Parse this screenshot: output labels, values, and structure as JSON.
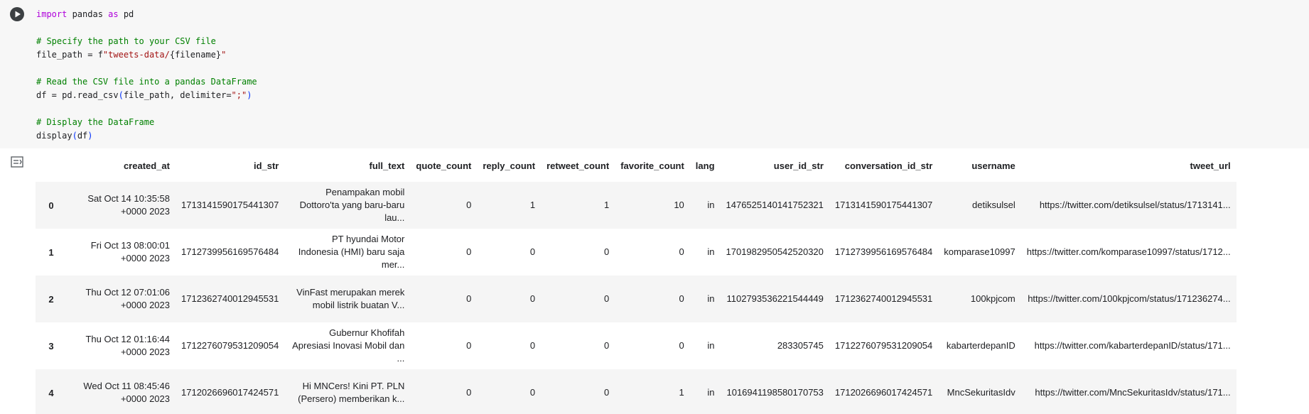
{
  "code": {
    "line1": {
      "kw1": "import",
      "mid": " pandas ",
      "kw2": "as",
      "end": " pd"
    },
    "line3": "# Specify the path to your CSV file",
    "line4": {
      "a": "file_path = f",
      "b": "\"tweets-data/",
      "c": "{filename}",
      "d": "\""
    },
    "line6": "# Read the CSV file into a pandas DataFrame",
    "line7": {
      "a": "df = pd.read_csv",
      "b": "(",
      "c": "file_path, delimiter=",
      "d": "\";\"",
      "e": ")"
    },
    "line9": "# Display the DataFrame",
    "line10": {
      "a": "display",
      "b": "(",
      "c": "df",
      "d": ")"
    }
  },
  "table": {
    "columns": [
      "created_at",
      "id_str",
      "full_text",
      "quote_count",
      "reply_count",
      "retweet_count",
      "favorite_count",
      "lang",
      "user_id_str",
      "conversation_id_str",
      "username",
      "tweet_url"
    ],
    "rows": [
      {
        "index": "0",
        "created_at": "Sat Oct 14 10:35:58 +0000 2023",
        "id_str": "1713141590175441307",
        "full_text": "Penampakan mobil Dottoro'ta yang baru-baru lau...",
        "quote_count": "0",
        "reply_count": "1",
        "retweet_count": "1",
        "favorite_count": "10",
        "lang": "in",
        "user_id_str": "1476525140141752321",
        "conversation_id_str": "1713141590175441307",
        "username": "detiksulsel",
        "tweet_url": "https://twitter.com/detiksulsel/status/1713141..."
      },
      {
        "index": "1",
        "created_at": "Fri Oct 13 08:00:01 +0000 2023",
        "id_str": "1712739956169576484",
        "full_text": "PT hyundai Motor Indonesia (HMI) baru saja mer...",
        "quote_count": "0",
        "reply_count": "0",
        "retweet_count": "0",
        "favorite_count": "0",
        "lang": "in",
        "user_id_str": "1701982950542520320",
        "conversation_id_str": "1712739956169576484",
        "username": "komparase10997",
        "tweet_url": "https://twitter.com/komparase10997/status/1712..."
      },
      {
        "index": "2",
        "created_at": "Thu Oct 12 07:01:06 +0000 2023",
        "id_str": "1712362740012945531",
        "full_text": "VinFast merupakan merek mobil listrik buatan V...",
        "quote_count": "0",
        "reply_count": "0",
        "retweet_count": "0",
        "favorite_count": "0",
        "lang": "in",
        "user_id_str": "1102793536221544449",
        "conversation_id_str": "1712362740012945531",
        "username": "100kpjcom",
        "tweet_url": "https://twitter.com/100kpjcom/status/171236274..."
      },
      {
        "index": "3",
        "created_at": "Thu Oct 12 01:16:44 +0000 2023",
        "id_str": "1712276079531209054",
        "full_text": "Gubernur Khofifah Apresiasi Inovasi Mobil dan ...",
        "quote_count": "0",
        "reply_count": "0",
        "retweet_count": "0",
        "favorite_count": "0",
        "lang": "in",
        "user_id_str": "283305745",
        "conversation_id_str": "1712276079531209054",
        "username": "kabarterdepanID",
        "tweet_url": "https://twitter.com/kabarterdepanID/status/171..."
      },
      {
        "index": "4",
        "created_at": "Wed Oct 11 08:45:46 +0000 2023",
        "id_str": "1712026696017424571",
        "full_text": "Hi MNCers! Kini PT. PLN (Persero) memberikan k...",
        "quote_count": "0",
        "reply_count": "0",
        "retweet_count": "0",
        "favorite_count": "1",
        "lang": "in",
        "user_id_str": "1016941198580170753",
        "conversation_id_str": "1712026696017424571",
        "username": "MncSekuritasIdv",
        "tweet_url": "https://twitter.com/MncSekuritasIdv/status/171..."
      }
    ]
  },
  "icons": {
    "run": "play-circle-icon",
    "output": "output-options-icon"
  }
}
